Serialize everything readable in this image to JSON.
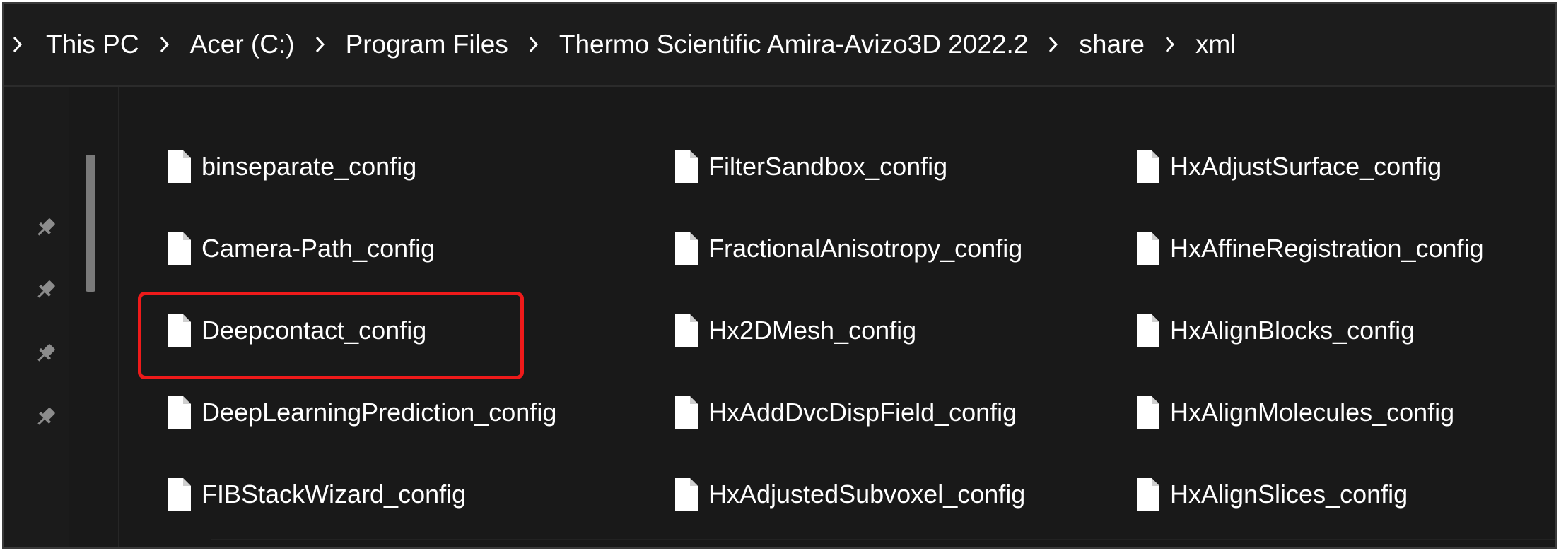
{
  "breadcrumb": {
    "items": [
      "This PC",
      "Acer (C:)",
      "Program Files",
      "Thermo Scientific Amira-Avizo3D 2022.2",
      "share",
      "xml"
    ]
  },
  "sidebar": {
    "pins": [
      "pin-icon",
      "pin-icon",
      "pin-icon",
      "pin-icon"
    ]
  },
  "files": {
    "columns": [
      [
        "binseparate_config",
        "Camera-Path_config",
        "Deepcontact_config",
        "DeepLearningPrediction_config",
        "FIBStackWizard_config"
      ],
      [
        "FilterSandbox_config",
        "FractionalAnisotropy_config",
        "Hx2DMesh_config",
        "HxAddDvcDispField_config",
        "HxAdjustedSubvoxel_config"
      ],
      [
        "HxAdjustSurface_config",
        "HxAffineRegistration_config",
        "HxAlignBlocks_config",
        "HxAlignMolecules_config",
        "HxAlignSlices_config"
      ]
    ],
    "highlighted": "Deepcontact_config"
  },
  "colors": {
    "background": "#191919",
    "text": "#ffffff",
    "highlight_border": "#ee1a1a"
  },
  "icons": {
    "file": "document-icon",
    "separator": "chevron-right-icon",
    "pin": "pin-icon"
  }
}
